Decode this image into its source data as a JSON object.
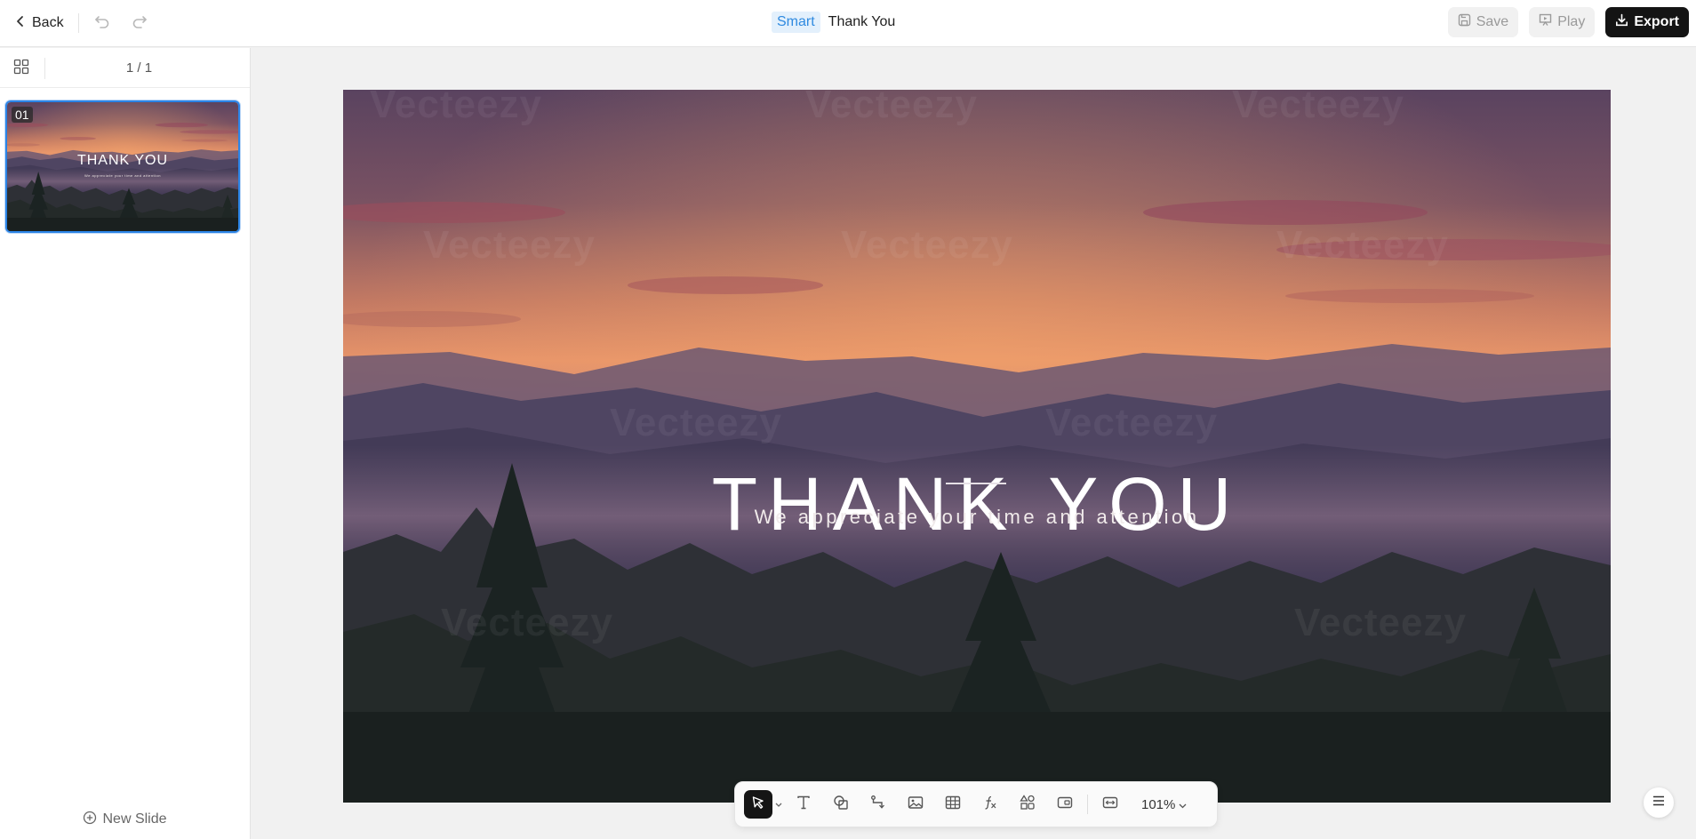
{
  "header": {
    "back_label": "Back",
    "smart_tag": "Smart",
    "doc_title": "Thank You",
    "save_label": "Save",
    "play_label": "Play",
    "export_label": "Export"
  },
  "sidebar": {
    "page_counter": "1 / 1",
    "thumbnail": {
      "number": "01",
      "title": "THANK YOU",
      "subtitle": "We appreciate your time and attention"
    },
    "new_slide_label": "New Slide"
  },
  "slide": {
    "title": "THANK YOU",
    "subtitle": "We appreciate your time and attention",
    "watermark": "Vecteezy"
  },
  "toolbar": {
    "tools": [
      "select",
      "text",
      "shape",
      "connector",
      "image",
      "table",
      "formula",
      "components",
      "media",
      "fit-width"
    ],
    "zoom": "101%"
  },
  "colors": {
    "accent": "#2b84e6",
    "smart_tag_bg": "#e3f0fc",
    "export_bg": "#141414",
    "sky_top": "#5a4360",
    "sky_glow": "#e7946a",
    "mountains": "#403a55",
    "forest": "#1b2322"
  }
}
